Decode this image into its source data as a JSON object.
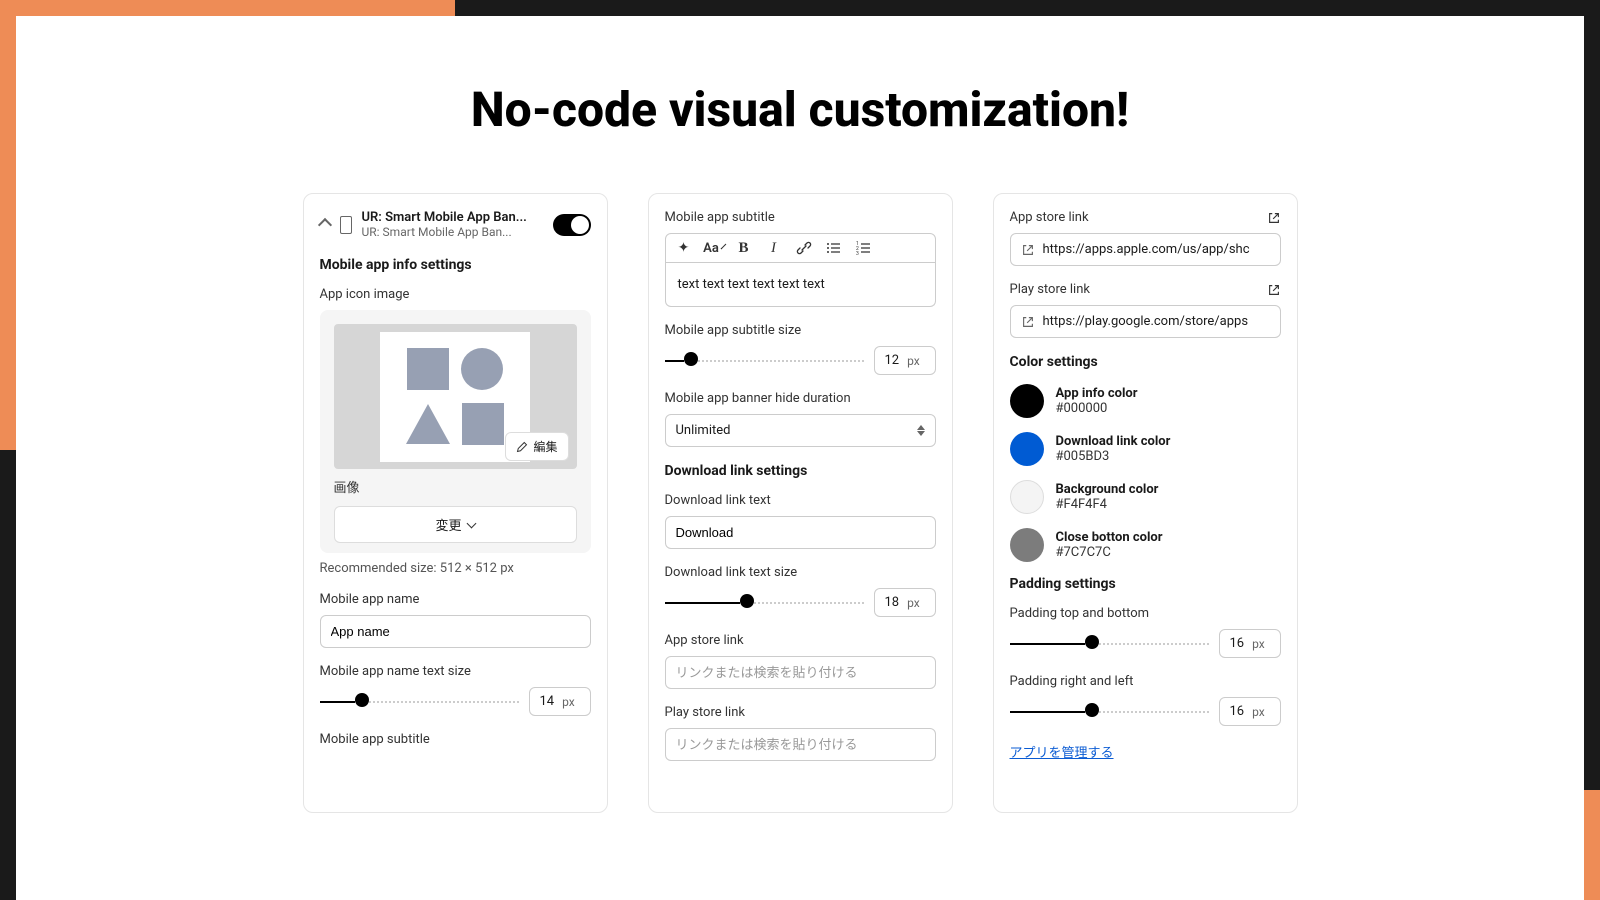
{
  "title": "No-code visual customization!",
  "panel1": {
    "header_title": "UR: Smart Mobile App Ban...",
    "header_sub": "UR: Smart Mobile App Ban...",
    "section_title": "Mobile app info settings",
    "app_icon_label": "App icon image",
    "edit_btn": "編集",
    "img_caption": "画像",
    "change_btn": "変更",
    "recommended": "Recommended size: 512 × 512 px",
    "app_name_label": "Mobile app name",
    "app_name_value": "App name",
    "app_name_size_label": "Mobile app name text size",
    "app_name_size_value": "14",
    "app_name_size_unit": "px",
    "subtitle_label": "Mobile app subtitle"
  },
  "panel2": {
    "subtitle_label": "Mobile app subtitle",
    "rte_aa": "Aa",
    "rte_bold": "B",
    "rte_italic": "I",
    "rte_content": "text text text text text text",
    "subtitle_size_label": "Mobile app subtitle size",
    "subtitle_size_value": "12",
    "subtitle_size_unit": "px",
    "hide_duration_label": "Mobile app banner hide duration",
    "hide_duration_value": "Unlimited",
    "dl_section": "Download link settings",
    "dl_text_label": "Download link text",
    "dl_text_value": "Download",
    "dl_size_label": "Download link text size",
    "dl_size_value": "18",
    "dl_size_unit": "px",
    "app_store_label": "App store link",
    "play_store_label": "Play store link",
    "link_placeholder": "リンクまたは検索を貼り付ける"
  },
  "panel3": {
    "app_store_label": "App store link",
    "app_store_value": "https://apps.apple.com/us/app/shc",
    "play_store_label": "Play store link",
    "play_store_value": "https://play.google.com/store/apps",
    "color_section": "Color settings",
    "colors": [
      {
        "name": "App info color",
        "hex": "#000000",
        "swatch": "#000000"
      },
      {
        "name": "Download link color",
        "hex": "#005BD3",
        "swatch": "#005BD3"
      },
      {
        "name": "Background color",
        "hex": "#F4F4F4",
        "swatch": "#F4F4F4"
      },
      {
        "name": "Close botton color",
        "hex": "#7C7C7C",
        "swatch": "#7C7C7C"
      }
    ],
    "padding_section": "Padding settings",
    "padding_tb_label": "Padding top and bottom",
    "padding_tb_value": "16",
    "padding_rl_label": "Padding right and left",
    "padding_rl_value": "16",
    "padding_unit": "px",
    "manage_link": "アプリを管理する"
  }
}
